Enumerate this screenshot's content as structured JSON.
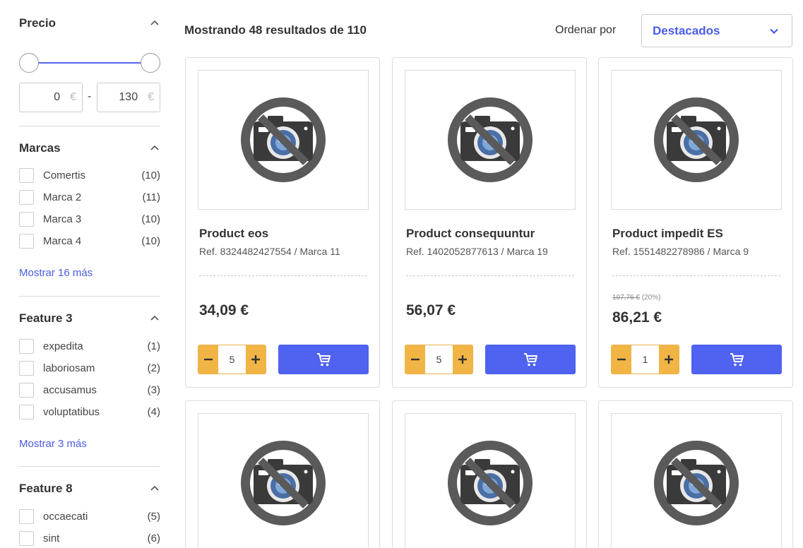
{
  "sidebar": {
    "price": {
      "title": "Precio",
      "min_value": "0",
      "max_value": "130",
      "currency": "€",
      "separator": "-"
    },
    "brands": {
      "title": "Marcas",
      "items": [
        {
          "label": "Comertis",
          "count": "(10)"
        },
        {
          "label": "Marca 2",
          "count": "(11)"
        },
        {
          "label": "Marca 3",
          "count": "(10)"
        },
        {
          "label": "Marca 4",
          "count": "(10)"
        }
      ],
      "more": "Mostrar 16 más"
    },
    "feature3": {
      "title": "Feature 3",
      "items": [
        {
          "label": "expedita",
          "count": "(1)"
        },
        {
          "label": "laboriosam",
          "count": "(2)"
        },
        {
          "label": "accusamus",
          "count": "(3)"
        },
        {
          "label": "voluptatibus",
          "count": "(4)"
        }
      ],
      "more": "Mostrar 3 más"
    },
    "feature8": {
      "title": "Feature 8",
      "items": [
        {
          "label": "occaecati",
          "count": "(5)"
        },
        {
          "label": "sint",
          "count": "(6)"
        }
      ]
    }
  },
  "toolbar": {
    "results_text": "Mostrando 48 resultados de 110",
    "sort_label": "Ordenar por",
    "sort_value": "Destacados"
  },
  "products": [
    {
      "name": "Product eos",
      "ref": "Ref. 8324482427554 / Marca 11",
      "price": "34,09 €",
      "old_price": "",
      "discount": "",
      "qty": "5"
    },
    {
      "name": "Product consequuntur",
      "ref": "Ref. 1402052877613 / Marca 19",
      "price": "56,07 €",
      "old_price": "",
      "discount": "",
      "qty": "5"
    },
    {
      "name": "Product impedit ES",
      "ref": "Ref. 1551482278986 / Marca 9",
      "price": "86,21 €",
      "old_price": "107,76 €",
      "discount": "(20%)",
      "qty": "1"
    }
  ],
  "colors": {
    "accent": "#4f62f0",
    "qty_button": "#f0b545"
  },
  "icons": {
    "no_image": "no-camera-icon",
    "cart": "cart-icon",
    "collapse": "chevron-up-icon",
    "sort": "chevron-down-icon"
  }
}
